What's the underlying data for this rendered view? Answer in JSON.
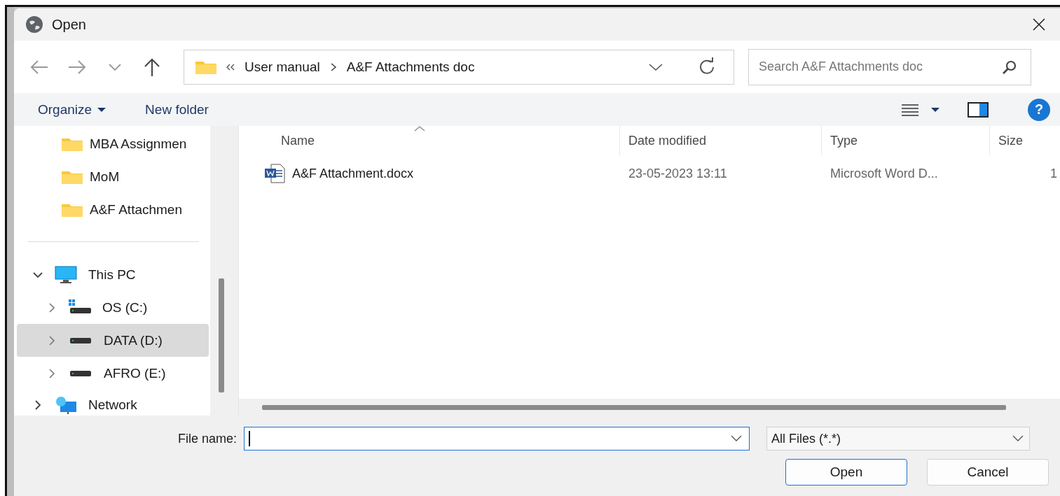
{
  "window": {
    "title": "Open"
  },
  "nav": {
    "path": [
      "User manual",
      "A&F Attachments doc"
    ],
    "search": {
      "placeholder": "Search A&F Attachments doc"
    }
  },
  "help": {
    "glyph": "?"
  },
  "commands": [
    {
      "label": "Organize",
      "menu": true
    },
    {
      "label": "New folder",
      "menu": false
    }
  ],
  "sidebar": {
    "pinned": [
      {
        "label": "MBA Assignmen",
        "selected": false
      },
      {
        "label": "MoM",
        "selected": false
      },
      {
        "label": "A&F Attachmen",
        "selected": false
      }
    ],
    "tree": [
      {
        "label": "This PC",
        "kind": "pc",
        "expanded": true,
        "selected": false,
        "children": [
          {
            "label": "OS (C:)",
            "kind": "system-drive",
            "expanded": false,
            "selected": false
          },
          {
            "label": "DATA (D:)",
            "kind": "drive",
            "expanded": false,
            "selected": true
          },
          {
            "label": "AFRO (E:)",
            "kind": "drive",
            "expanded": false,
            "selected": false
          }
        ]
      },
      {
        "label": "Network",
        "kind": "network",
        "expanded": false,
        "selected": false
      }
    ]
  },
  "table": {
    "columns": [
      {
        "label": "Name",
        "sorted": true
      },
      {
        "label": "Date modified",
        "sorted": false
      },
      {
        "label": "Type",
        "sorted": false
      },
      {
        "label": "Size",
        "sorted": false
      }
    ],
    "rows": [
      {
        "name": "A&F Attachment.docx",
        "date": "23-05-2023 13:11",
        "type": "Microsoft Word D...",
        "size": "1",
        "selected": false
      }
    ]
  },
  "footer": {
    "file_name_label": "File name:",
    "filter": "All Files (*.*)",
    "buttons": [
      {
        "label": "Open",
        "default": true
      },
      {
        "label": "Cancel",
        "default": false
      }
    ]
  }
}
